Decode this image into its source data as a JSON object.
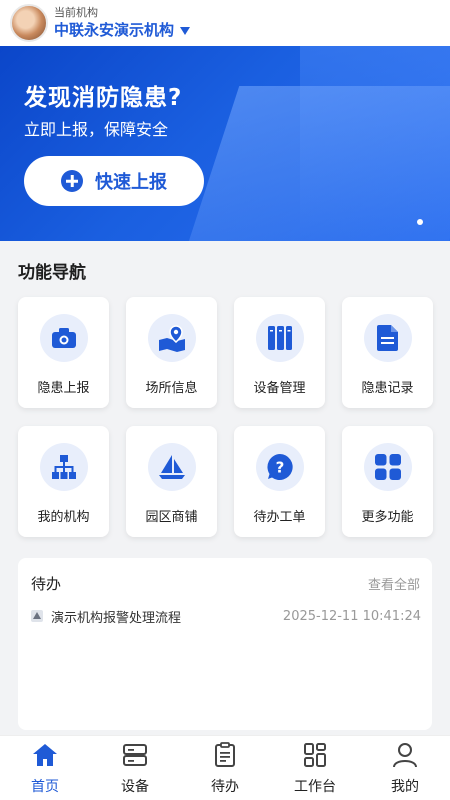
{
  "header": {
    "org_label": "当前机构",
    "org_name": "中联永安演示机构"
  },
  "banner": {
    "title": "发现消防隐患?",
    "subtitle": "立即上报，保障安全",
    "quick_button": "快速上报"
  },
  "nav_section": {
    "title": "功能导航"
  },
  "features": [
    {
      "label": "隐患上报",
      "icon": "camera-icon"
    },
    {
      "label": "场所信息",
      "icon": "map-pin-icon"
    },
    {
      "label": "设备管理",
      "icon": "binders-icon"
    },
    {
      "label": "隐患记录",
      "icon": "document-icon"
    },
    {
      "label": "我的机构",
      "icon": "org-chart-icon"
    },
    {
      "label": "园区商铺",
      "icon": "sailboat-icon"
    },
    {
      "label": "待办工单",
      "icon": "question-icon"
    },
    {
      "label": "更多功能",
      "icon": "grid-icon"
    }
  ],
  "pending": {
    "title": "待办",
    "view_all": "查看全部",
    "items": [
      {
        "text": "演示机构报警处理流程",
        "time": "2025-12-11 10:41:24"
      }
    ]
  },
  "tabbar": {
    "items": [
      {
        "label": "首页",
        "icon": "home-icon",
        "active": true
      },
      {
        "label": "设备",
        "icon": "device-icon",
        "active": false
      },
      {
        "label": "待办",
        "icon": "clipboard-icon",
        "active": false
      },
      {
        "label": "工作台",
        "icon": "workbench-icon",
        "active": false
      },
      {
        "label": "我的",
        "icon": "user-icon",
        "active": false
      }
    ]
  },
  "colors": {
    "primary": "#1f5ad6",
    "icon_bg": "#e8eefb",
    "page_bg": "#f2f3f5"
  }
}
